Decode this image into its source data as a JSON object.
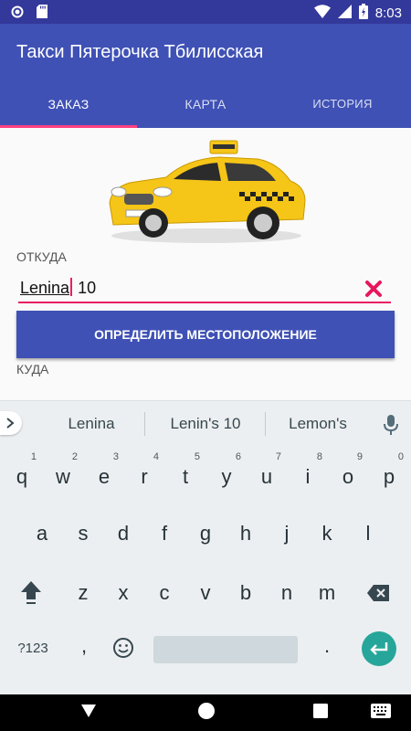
{
  "status_bar": {
    "time": "8:03"
  },
  "app_bar": {
    "title": "Такси Пятерочка Тбилисская",
    "tabs": [
      {
        "label": "ЗАКАЗ",
        "active": true
      },
      {
        "label": "КАРТА",
        "active": false
      },
      {
        "label": "ИСТОРИЯ",
        "active": false
      }
    ]
  },
  "form": {
    "from_label": "ОТКУДА",
    "from_value_part1": "Lenina",
    "from_value_part2": " 10",
    "locate_button": "ОПРЕДЕЛИТЬ МЕСТОПОЛОЖЕНИЕ",
    "to_label": "КУДА"
  },
  "keyboard": {
    "suggestions": [
      "Lenina",
      "Lenin's 10",
      "Lemon's"
    ],
    "row1": [
      {
        "key": "q",
        "hint": "1"
      },
      {
        "key": "w",
        "hint": "2"
      },
      {
        "key": "e",
        "hint": "3"
      },
      {
        "key": "r",
        "hint": "4"
      },
      {
        "key": "t",
        "hint": "5"
      },
      {
        "key": "y",
        "hint": "6"
      },
      {
        "key": "u",
        "hint": "7"
      },
      {
        "key": "i",
        "hint": "8"
      },
      {
        "key": "o",
        "hint": "9"
      },
      {
        "key": "p",
        "hint": "0"
      }
    ],
    "row2": [
      "a",
      "s",
      "d",
      "f",
      "g",
      "h",
      "j",
      "k",
      "l"
    ],
    "row3": [
      "z",
      "x",
      "c",
      "v",
      "b",
      "n",
      "m"
    ],
    "symbols_key": "?123",
    "comma_key": ",",
    "period_key": "."
  },
  "colors": {
    "primary": "#3f51b5",
    "primary_dark": "#33389b",
    "accent": "#ff4081",
    "field_underline": "#e91e63",
    "clear_icon": "#e8175d",
    "enter_key": "#26a69a"
  }
}
